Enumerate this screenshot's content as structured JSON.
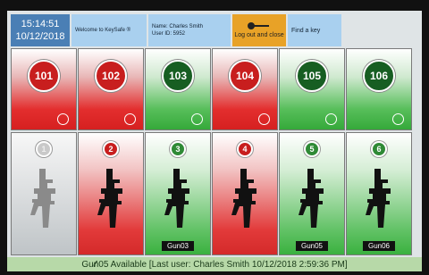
{
  "header": {
    "time": "15:14:51",
    "date": "10/12/2018",
    "welcome": "Welcome to KeySafe ®",
    "user_name": "Name: Charles Smith",
    "user_id": "User ID: 5952",
    "logout_label": "Log out and close",
    "find_key_label": "Find a key"
  },
  "top_slots": [
    {
      "number": "101",
      "state": "red"
    },
    {
      "number": "102",
      "state": "red"
    },
    {
      "number": "103",
      "state": "green"
    },
    {
      "number": "104",
      "state": "red"
    },
    {
      "number": "105",
      "state": "green"
    },
    {
      "number": "106",
      "state": "green"
    }
  ],
  "bottom_slots": [
    {
      "number": "1",
      "state": "grey",
      "label": ""
    },
    {
      "number": "2",
      "state": "red",
      "label": ""
    },
    {
      "number": "3",
      "state": "green",
      "label": "Gun03"
    },
    {
      "number": "4",
      "state": "red",
      "label": ""
    },
    {
      "number": "5",
      "state": "green",
      "label": "Gun05"
    },
    {
      "number": "6",
      "state": "green",
      "label": "Gun06"
    }
  ],
  "status_text": "Gun05 Available [Last user: Charles Smith 10/12/2018 2:59:36 PM]",
  "colors": {
    "red": "#c81e1e",
    "green": "#175e22",
    "header_blue": "#a9d0ef",
    "logout_orange": "#e8a227",
    "status_green": "#b7d9a8"
  }
}
